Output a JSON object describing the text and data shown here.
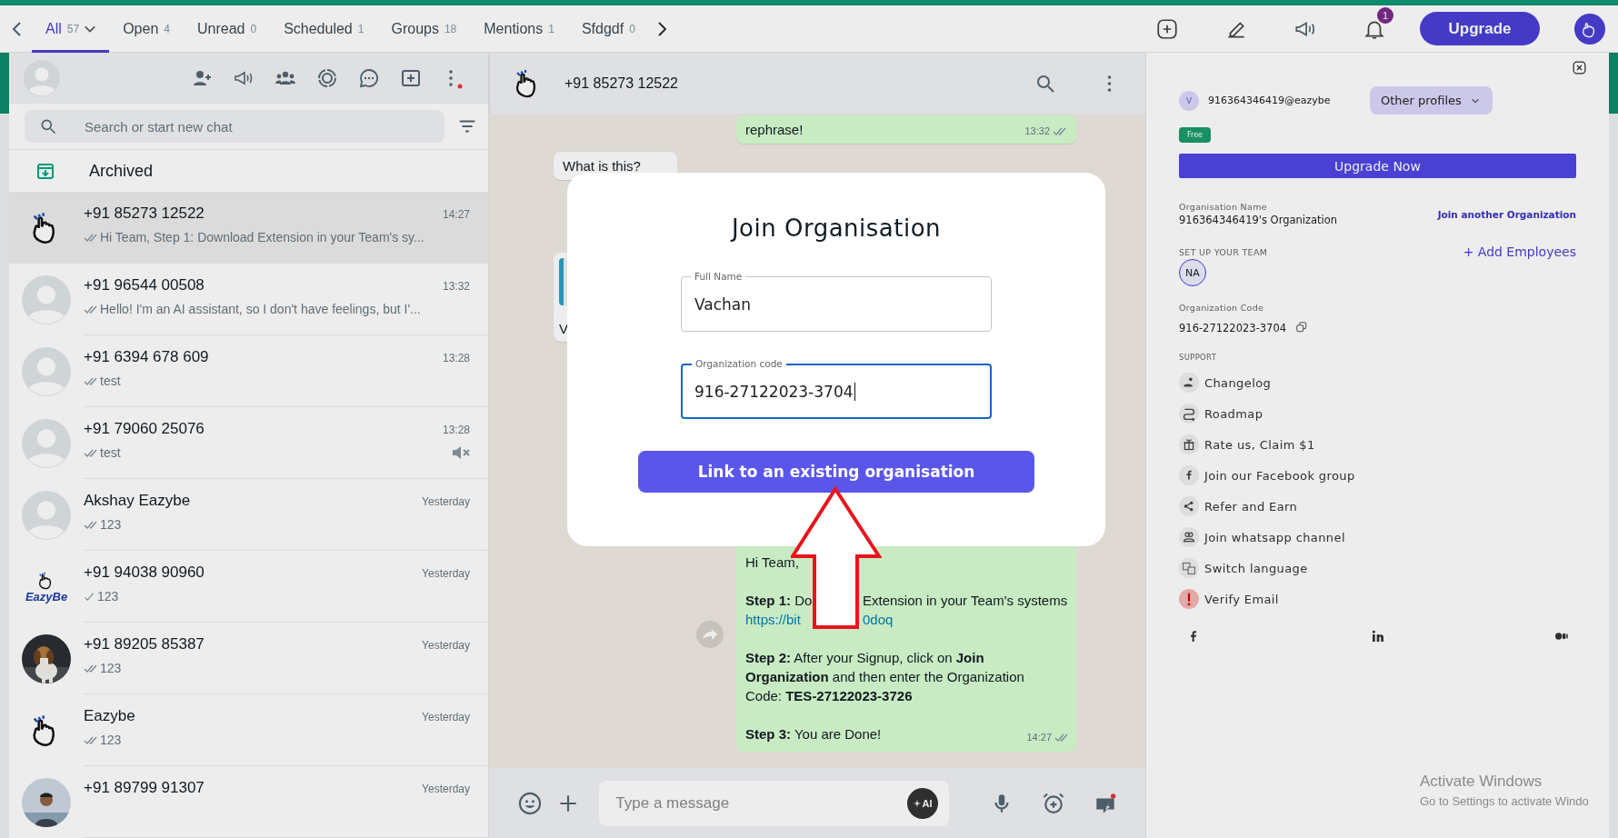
{
  "top_bar": {
    "tabs": [
      {
        "label": "All",
        "count": "57",
        "selected": true,
        "dropdown": true
      },
      {
        "label": "Open",
        "count": "4",
        "selected": false,
        "dropdown": false
      },
      {
        "label": "Unread",
        "count": "0",
        "selected": false,
        "dropdown": false
      },
      {
        "label": "Scheduled",
        "count": "1",
        "selected": false,
        "dropdown": false
      },
      {
        "label": "Groups",
        "count": "18",
        "selected": false,
        "dropdown": false
      },
      {
        "label": "Mentions",
        "count": "1",
        "selected": false,
        "dropdown": false
      },
      {
        "label": "Sfdgdf",
        "count": "0",
        "selected": false,
        "dropdown": false
      }
    ],
    "notification_count": "1",
    "upgrade_label": "Upgrade"
  },
  "sidebar": {
    "search_placeholder": "Search or start new chat",
    "archived_label": "Archived",
    "chats": [
      {
        "kind": "hand",
        "name": "+91 85273 12522",
        "time": "14:27",
        "preview": "Hi Team,  Step 1: Download Extension in your Team's sy...",
        "delivered": true,
        "muted": false,
        "selected": true
      },
      {
        "kind": "default",
        "name": "+91 96544 00508",
        "time": "13:32",
        "preview": "Hello! I'm an AI assistant, so I don't have feelings, but I'...",
        "delivered": true,
        "muted": false,
        "selected": false
      },
      {
        "kind": "default",
        "name": "+91 6394 678 609",
        "time": "13:28",
        "preview": "test",
        "delivered": true,
        "muted": false,
        "selected": false
      },
      {
        "kind": "default",
        "name": "+91 79060 25076",
        "time": "13:28",
        "preview": "test",
        "delivered": true,
        "muted": true,
        "selected": false
      },
      {
        "kind": "default",
        "name": "Akshay Eazybe",
        "time": "Yesterday",
        "preview": "123",
        "delivered": true,
        "muted": false,
        "selected": false
      },
      {
        "kind": "brand",
        "avatar_text": "EazyBe",
        "name": "+91 94038 90960",
        "time": "Yesterday",
        "preview": "123",
        "delivered": false,
        "muted": false,
        "selected": false
      },
      {
        "name": "+91 89205 85387",
        "time": "Yesterday",
        "preview": "123",
        "delivered": true,
        "muted": false,
        "selected": false
      },
      {
        "kind": "hand",
        "name": "Eazybe",
        "time": "Yesterday",
        "preview": "123",
        "delivered": true,
        "muted": false,
        "selected": false
      },
      {
        "name": "+91 89799 91307",
        "time": "Yesterday",
        "muted": false,
        "selected": false
      }
    ]
  },
  "chat": {
    "title": "+91 85273 12522",
    "messages": [
      {
        "kind": "outgoing",
        "text": "rephrase!",
        "time": "13:32"
      },
      {
        "kind": "incoming",
        "text": "What is this?"
      },
      {
        "kind": "quoted",
        "text": "V"
      },
      {
        "kind": "rich",
        "time": "14:27",
        "forward": true,
        "paragraphs": [
          [
            {
              "kind": "text",
              "text": "Hi Team,"
            }
          ],
          [
            {
              "kind": "split",
              "parts": [
                "**Step 1:** Do",
                "Extension in your Team's systems"
              ]
            },
            {
              "kind": "link_split",
              "parts": [
                "https://bit",
                "0doq"
              ]
            }
          ],
          [
            {
              "kind": "text",
              "text": "**Step 2:** After your Signup, click on **Join Organization** and then enter the Organization Code: **TES-27122023-3726**"
            }
          ],
          [
            {
              "kind": "text",
              "text": "**Step 3:** You are Done!"
            }
          ]
        ]
      }
    ],
    "composer_placeholder": "Type a message",
    "ai_label": "AI"
  },
  "dialog": {
    "title": "Join Organisation",
    "fields": [
      {
        "label": "Full Name",
        "value": "Vachan",
        "focused": false
      },
      {
        "label": "Organization code",
        "value": "916-27122023-3704",
        "focused": true
      }
    ],
    "button": "Link to an existing organisation"
  },
  "profile_panel": {
    "initial": "V",
    "account": "916364346419@eazybe",
    "profiles_button": "Other profiles",
    "plan": "Free",
    "upgrade_button": "Upgrade Now",
    "org_name_label": "Organisation Name",
    "org_name": "916364346419's Organization",
    "join_link": "Join another Organization",
    "team_label": "SET UP YOUR TEAM",
    "add_link": "+ Add Employees",
    "team_members": [
      {
        "initials": "NA"
      }
    ],
    "org_code_label": "Organization Code",
    "org_code": "916-27122023-3704",
    "support_label": "SUPPORT",
    "support_items": [
      "Changelog",
      "Roadmap",
      "Rate us, Claim $1",
      "Join our Facebook group",
      "Refer and Earn",
      "Join whatsapp channel",
      "Switch language",
      "Verify Email"
    ]
  },
  "os_notice": {
    "title": "Activate Windows",
    "subtitle": "Go to Settings to activate Windo"
  }
}
